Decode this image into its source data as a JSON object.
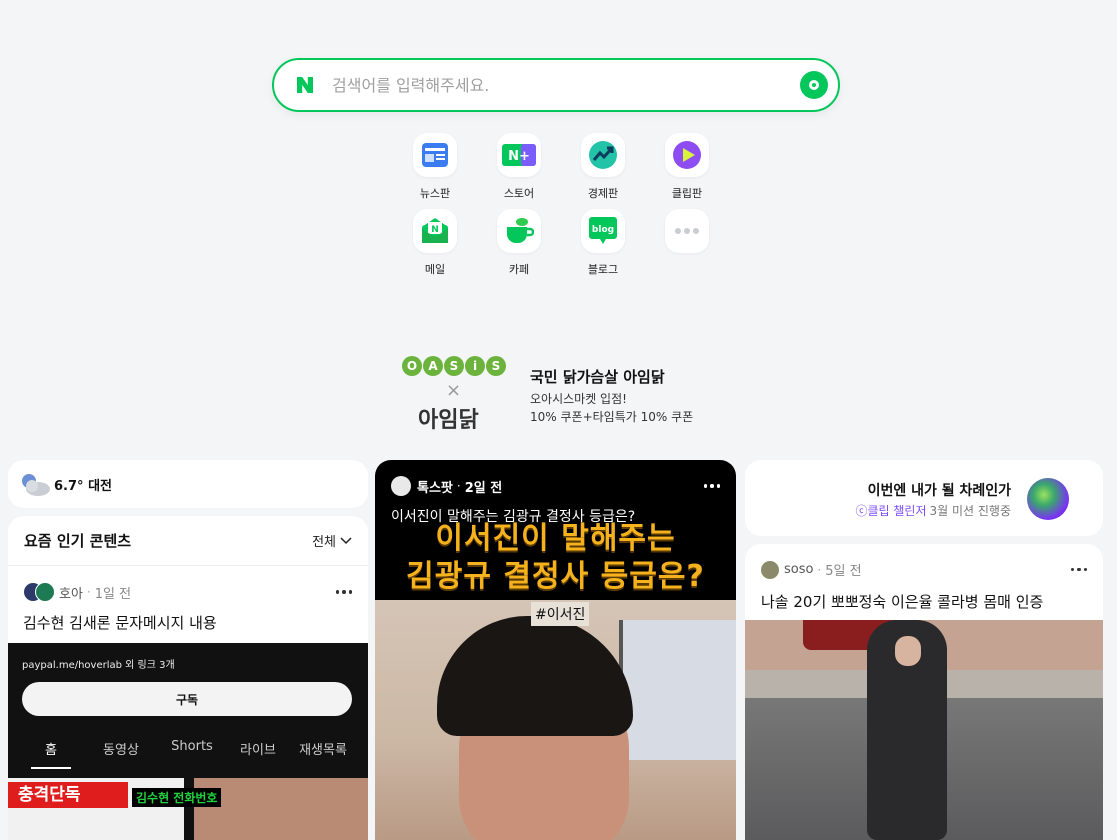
{
  "search": {
    "placeholder": "검색어를 입력해주세요."
  },
  "shortcuts": [
    {
      "label": "뉴스판",
      "icon": "news-icon"
    },
    {
      "label": "스토어",
      "icon": "store-icon"
    },
    {
      "label": "경제판",
      "icon": "economy-icon"
    },
    {
      "label": "클립판",
      "icon": "clip-icon"
    },
    {
      "label": "메일",
      "icon": "mail-icon"
    },
    {
      "label": "카페",
      "icon": "cafe-icon"
    },
    {
      "label": "블로그",
      "icon": "blog-icon"
    },
    {
      "label": "",
      "icon": "more-icon"
    }
  ],
  "shortcut_icon_text": {
    "store": "N+",
    "blog": "blog",
    "mail": "N"
  },
  "ad": {
    "logo_letters": [
      "O",
      "A",
      "S",
      "i",
      "S"
    ],
    "logo_x": "×",
    "brand": "아임닭",
    "title": "국민 닭가슴살 아임닭",
    "line1": "오아시스마켓 입점!",
    "line2": "10% 쿠폰+타임특가 10% 쿠폰"
  },
  "weather": {
    "temp": "6.7°",
    "city": "대전"
  },
  "popular": {
    "header": "요즘 인기 콘텐츠",
    "filter": "전체",
    "author": "호아",
    "time": "1일 전",
    "title": "김수현 김새론 문자메시지 내용",
    "shot": {
      "link_text": "paypal.me/hoverlab 외 링크 3개",
      "subscribe": "구독",
      "tabs": [
        "홈",
        "동영상",
        "Shorts",
        "라이브",
        "재생목록"
      ],
      "tag": "충격단독",
      "tag2": "김수현 전화번호"
    }
  },
  "video": {
    "source": "톡스팟",
    "time": "2일 전",
    "title": "이서진이 말해주는 김광규 결정사 등급은?",
    "caption_line1": "이서진이 말해주는",
    "caption_line2": "김광규 결정사 등급은?",
    "chip": "#이서진"
  },
  "challenge": {
    "title": "이번엔 내가 될 차례인가",
    "badge": "ⓒ클립 챌린저",
    "detail": "3월 미션 진행중"
  },
  "post": {
    "author": "soso",
    "time": "5일 전",
    "title": "나솔 20기 뽀뽀정숙 이은율 콜라병 몸매 인증"
  },
  "colors": {
    "brand_green": "#03c75a",
    "page_bg": "#f4f5f7",
    "caption_orange": "#f5b21c",
    "challenge_purple": "#7b4cff"
  }
}
